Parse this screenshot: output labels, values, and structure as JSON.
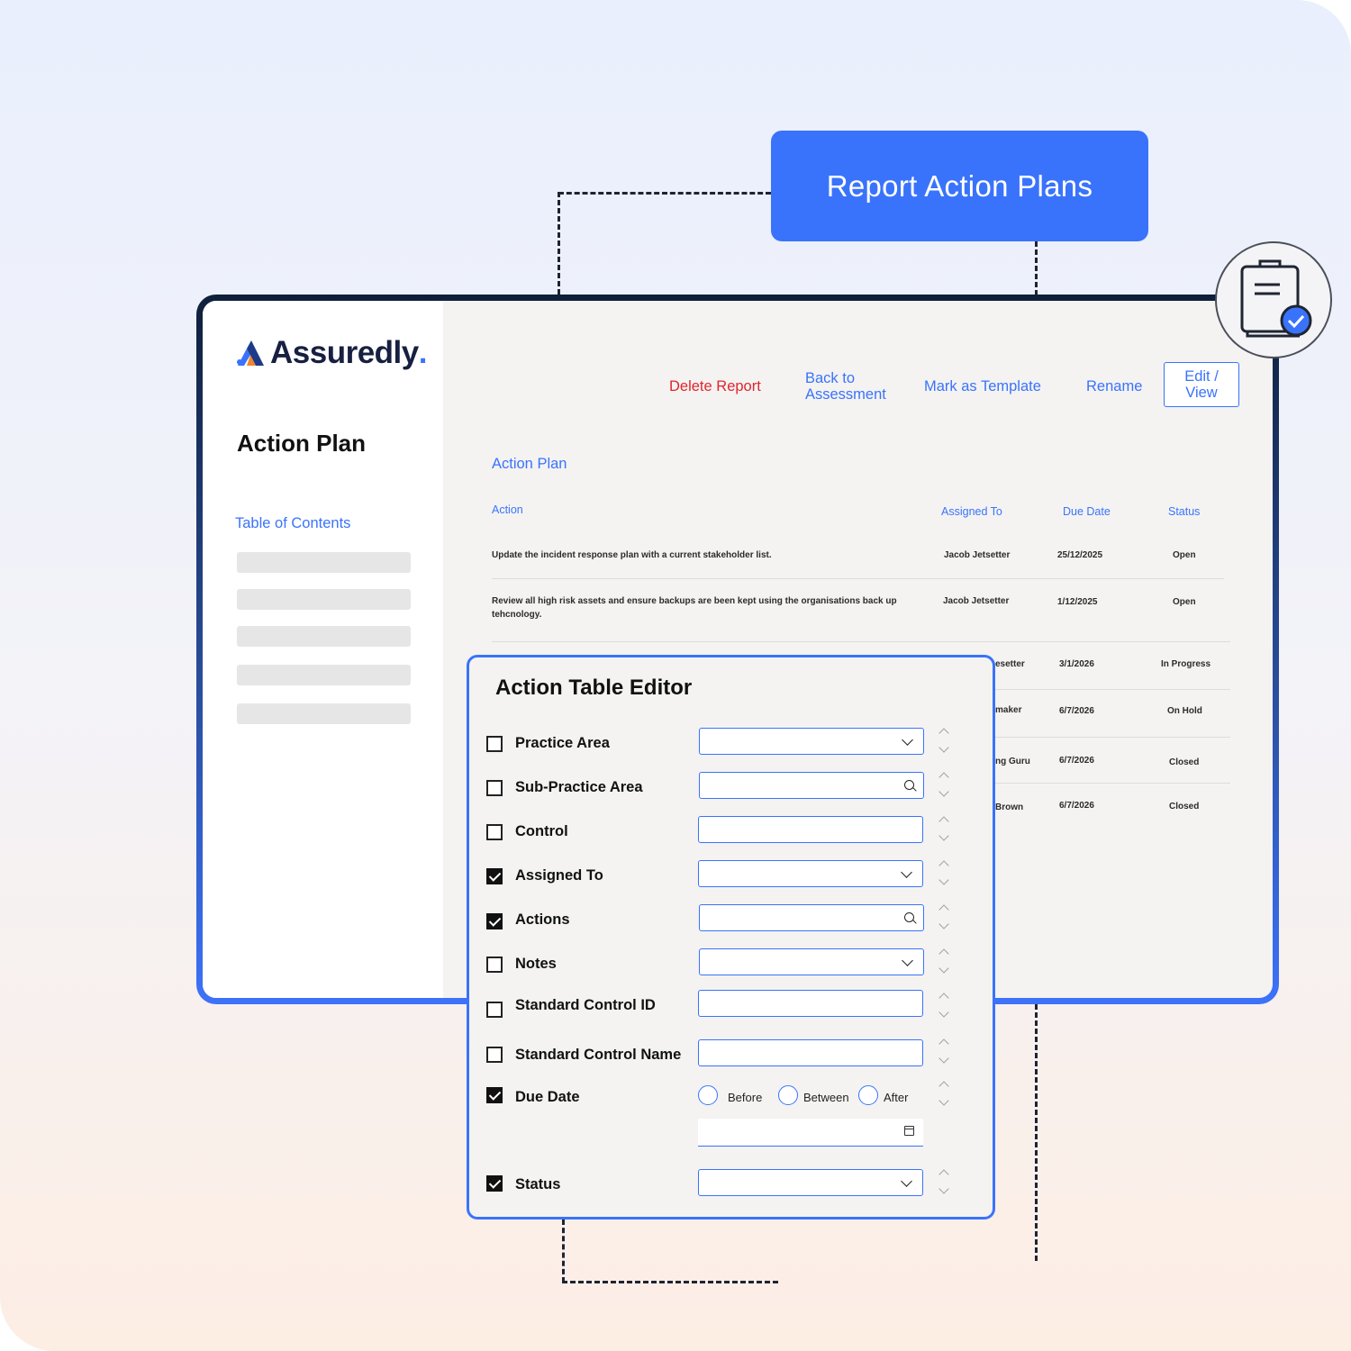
{
  "badge": {
    "label": "Report Action Plans"
  },
  "brand": {
    "name": "Assuredly",
    "dot": "."
  },
  "sidebar": {
    "title": "Action Plan",
    "toc_label": "Table of Contents"
  },
  "topnav": {
    "delete": "Delete Report",
    "back_line1": "Back to",
    "back_line2": "Assessment",
    "template": "Mark as Template",
    "rename": "Rename",
    "edit_line1": "Edit /",
    "edit_line2": "View"
  },
  "action_plan": {
    "title": "Action Plan",
    "columns": {
      "action": "Action",
      "assigned": "Assigned To",
      "due": "Due Date",
      "status": "Status"
    },
    "rows": [
      {
        "action": "Update the incident response plan with a current stakeholder list.",
        "assigned": "Jacob Jetsetter",
        "due": "25/12/2025",
        "status": "Open"
      },
      {
        "action": "Review all high risk assets and ensure backups are been kept using the organisations back up tehcnology.",
        "assigned": "Jacob Jetsetter",
        "due": "1/12/2025",
        "status": "Open"
      },
      {
        "action": "",
        "assigned": "esetter",
        "due": "3/1/2026",
        "status": "In Progress"
      },
      {
        "action": "",
        "assigned": "maker",
        "due": "6/7/2026",
        "status": "On Hold"
      },
      {
        "action": "",
        "assigned": "ng Guru",
        "due": "6/7/2026",
        "status": "Closed"
      },
      {
        "action": "",
        "assigned": "Brown",
        "due": "6/7/2026",
        "status": "Closed"
      }
    ]
  },
  "editor": {
    "title": "Action Table Editor",
    "fields": [
      {
        "label": "Practice Area",
        "checked": false,
        "control": "dropdown"
      },
      {
        "label": "Sub-Practice Area",
        "checked": false,
        "control": "search"
      },
      {
        "label": "Control",
        "checked": false,
        "control": "text"
      },
      {
        "label": "Assigned To",
        "checked": true,
        "control": "dropdown"
      },
      {
        "label": "Actions",
        "checked": true,
        "control": "search"
      },
      {
        "label": "Notes",
        "checked": false,
        "control": "dropdown"
      },
      {
        "label": "Standard Control ID",
        "checked": false,
        "control": "text"
      },
      {
        "label": "Standard Control Name",
        "checked": false,
        "control": "text"
      },
      {
        "label": "Due Date",
        "checked": true,
        "control": "date"
      },
      {
        "label": "Status",
        "checked": true,
        "control": "dropdown"
      }
    ],
    "due_options": {
      "before": "Before",
      "between": "Between",
      "after": "After"
    }
  },
  "colors": {
    "accent": "#3a73fb",
    "danger": "#e0262d",
    "dark": "#172040"
  },
  "icons": {
    "badge_icon": "clipboard-check-icon"
  }
}
